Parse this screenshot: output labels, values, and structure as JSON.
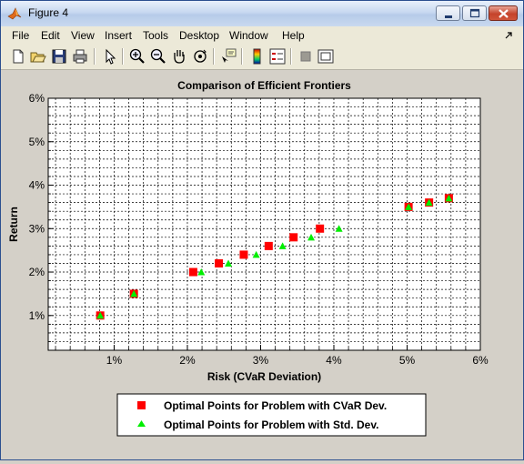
{
  "window": {
    "title": "Figure 4",
    "controls": {
      "minimize": "minimize",
      "maximize": "maximize",
      "close": "close"
    }
  },
  "menu": [
    "File",
    "Edit",
    "View",
    "Insert",
    "Tools",
    "Desktop",
    "Window",
    "Help"
  ],
  "toolbar": {
    "icons": [
      "new-figure-icon",
      "open-file-icon",
      "save-icon",
      "print-icon",
      "edit-plot-arrow-icon",
      "zoom-in-icon",
      "zoom-out-icon",
      "pan-hand-icon",
      "rotate-3d-icon",
      "data-cursor-icon",
      "colorbar-icon",
      "legend-icon",
      "hide-plot-tools-icon",
      "show-plot-tools-icon"
    ]
  },
  "chart_data": {
    "type": "scatter",
    "title": "Comparison of Efficient Frontiers",
    "xlabel": "Risk (CVaR Deviation)",
    "ylabel": "Return",
    "xlim": [
      0.001,
      0.06
    ],
    "ylim": [
      0.002,
      0.06
    ],
    "xticks": [
      0.01,
      0.02,
      0.03,
      0.04,
      0.05,
      0.06
    ],
    "xtick_labels": [
      "1%",
      "2%",
      "3%",
      "4%",
      "5%",
      "6%"
    ],
    "yticks": [
      0.01,
      0.02,
      0.03,
      0.04,
      0.05,
      0.06
    ],
    "ytick_labels": [
      "1%",
      "2%",
      "3%",
      "4%",
      "5%",
      "6%"
    ],
    "grid": true,
    "grid_style": "dashed",
    "legend_position": "below plot",
    "series": [
      {
        "name": "Optimal Points for Problem with CVaR Dev.",
        "marker": "square",
        "color": "#ff0000",
        "x": [
          0.0081,
          0.0127,
          0.0208,
          0.0243,
          0.0277,
          0.0311,
          0.0345,
          0.0381,
          0.0502,
          0.053,
          0.0557
        ],
        "y": [
          0.01,
          0.015,
          0.02,
          0.022,
          0.024,
          0.026,
          0.028,
          0.03,
          0.035,
          0.036,
          0.037
        ]
      },
      {
        "name": "Optimal Points for Problem with Std. Dev.",
        "marker": "triangle",
        "color": "#00ee00",
        "x": [
          0.0081,
          0.0127,
          0.0219,
          0.0256,
          0.0294,
          0.033,
          0.0369,
          0.0407,
          0.0502,
          0.053,
          0.0557
        ],
        "y": [
          0.01,
          0.015,
          0.02,
          0.022,
          0.024,
          0.026,
          0.028,
          0.03,
          0.035,
          0.036,
          0.037
        ]
      }
    ]
  }
}
